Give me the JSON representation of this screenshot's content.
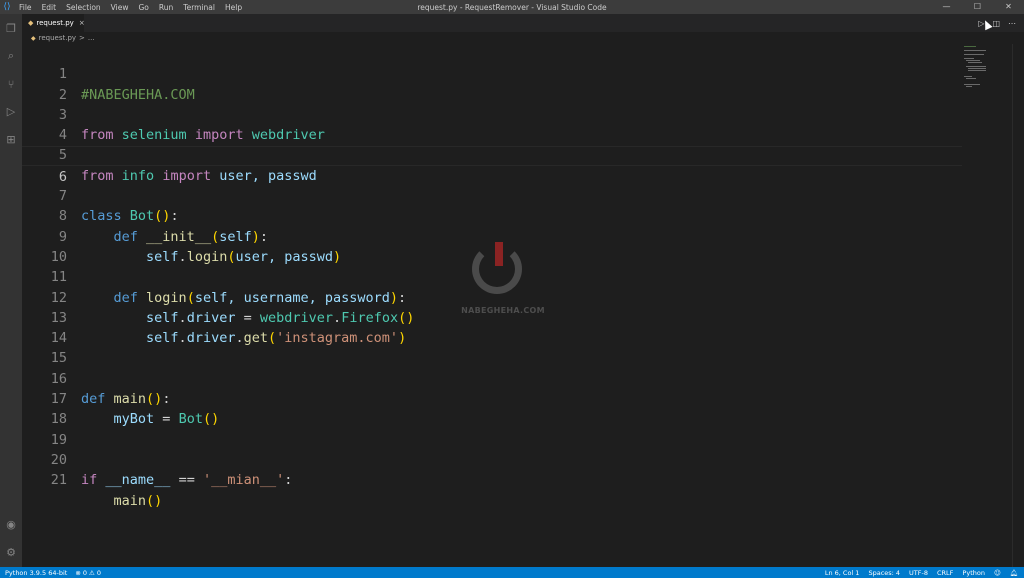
{
  "window": {
    "title": "request.py - RequestRemover - Visual Studio Code",
    "menu": [
      "File",
      "Edit",
      "Selection",
      "View",
      "Go",
      "Run",
      "Terminal",
      "Help"
    ],
    "controls": {
      "minimize": "—",
      "maximize": "☐",
      "close": "✕"
    }
  },
  "tab": {
    "label": "request.py",
    "close": "×"
  },
  "breadcrumb": {
    "file": "request.py",
    "sep": ">",
    "rest": "..."
  },
  "editor": {
    "line_numbers": [
      "1",
      "2",
      "3",
      "4",
      "5",
      "6",
      "7",
      "8",
      "9",
      "10",
      "11",
      "12",
      "13",
      "14",
      "15",
      "16",
      "17",
      "18",
      "19",
      "20",
      "21"
    ],
    "current_line": "6",
    "lines": {
      "l1": {
        "comment": "#NABEGHEHA.COM"
      },
      "l3": {
        "from": "from",
        "module": "selenium",
        "import": "import",
        "name": "webdriver"
      },
      "l5": {
        "from": "from",
        "module": "info",
        "import": "import",
        "names": "user, passwd"
      },
      "l7": {
        "class": "class",
        "name": "Bot",
        "parens": "()",
        "colon": ":"
      },
      "l8": {
        "def": "def",
        "name": "__init__",
        "open": "(",
        "self": "self",
        "close": ")",
        "colon": ":"
      },
      "l9": {
        "self": "self",
        "method": "login",
        "open": "(",
        "args": "user, passwd",
        "close": ")"
      },
      "l11": {
        "def": "def",
        "name": "login",
        "open": "(",
        "params": "self, username, password",
        "close": ")",
        "colon": ":"
      },
      "l12": {
        "self": "self",
        "attr": "driver",
        "eq": "=",
        "mod": "webdriver",
        "cls": "Firefox",
        "parens": "()"
      },
      "l13": {
        "self": "self",
        "attr": "driver",
        "method": "get",
        "open": "(",
        "arg": "'instagram.com'",
        "close": ")"
      },
      "l16": {
        "def": "def",
        "name": "main",
        "parens": "()",
        "colon": ":"
      },
      "l17": {
        "var": "myBot",
        "eq": "=",
        "cls": "Bot",
        "parens": "()"
      },
      "l20": {
        "if": "if",
        "name": "__name__",
        "op": "==",
        "str": "'__mian__'",
        "colon": ":"
      },
      "l21": {
        "call": "main",
        "parens": "()"
      }
    }
  },
  "watermark": {
    "text": "NABEGHEHA.COM"
  },
  "statusbar": {
    "python": "Python 3.9.5 64-bit",
    "problems": "⊗ 0 ⚠ 0",
    "position": "Ln 6, Col 1",
    "spaces": "Spaces: 4",
    "encoding": "UTF-8",
    "eol": "CRLF",
    "language": "Python"
  }
}
